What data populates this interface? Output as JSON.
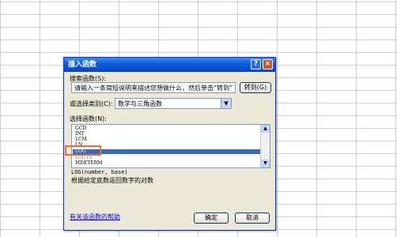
{
  "dialog": {
    "title": "插入函数",
    "help_glyph": "?",
    "close_glyph": "×",
    "search_label": "搜索函数(S):",
    "search_value": "请输入一条简短说明来描述您想做什么，然后单击“转到”",
    "go_button": "转到(G)",
    "category_label": "或选择类别(C):",
    "category_value": "数学与三角函数",
    "category_arrow": "▼",
    "select_label": "选择函数(N):",
    "functions": [
      "GCD",
      "INT",
      "LCM",
      "LN",
      "LOG",
      "LOG10",
      "MDETERM"
    ],
    "selected_function": "LOG",
    "scroll_up": "▲",
    "scroll_down": "▼",
    "signature": "LOG(number, base)",
    "description": "根据给定底数返回数字的对数",
    "help_link": "有关该函数的帮助",
    "ok_button": "确定",
    "cancel_button": "取消"
  }
}
